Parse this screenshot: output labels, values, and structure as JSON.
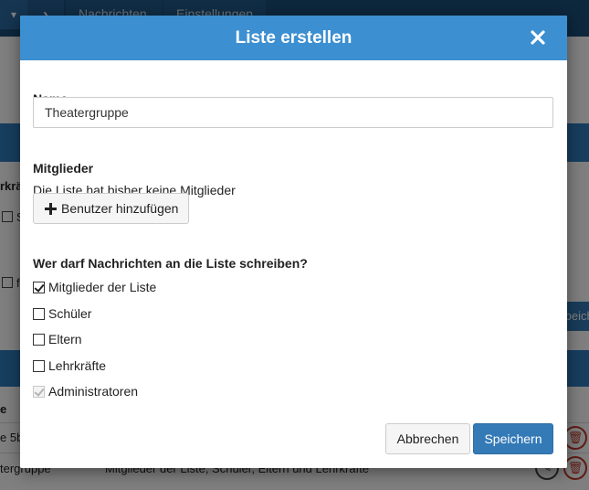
{
  "background": {
    "tabs": [
      "Nachrichten",
      "Einstellungen"
    ],
    "left_labels": [
      "rkrä",
      "S",
      "f"
    ],
    "save_label": "Speich",
    "table_header": "e",
    "rows": [
      {
        "name": "e 5b",
        "members": ""
      },
      {
        "name": "tergruppe",
        "members": "Mitglieder der Liste, Schüler, Eltern und Lehrkräfte"
      }
    ]
  },
  "modal": {
    "title": "Liste erstellen",
    "close_icon": "close-icon",
    "name_label": "Name",
    "name_value": "Theatergruppe",
    "members_label": "Mitglieder",
    "members_empty_text": "Die Liste hat bisher keine Mitglieder",
    "add_user_label": "Benutzer hinzufügen",
    "add_user_icon": "plus-icon",
    "permissions_label": "Wer darf Nachrichten an die Liste schreiben?",
    "permissions": [
      {
        "label": "Mitglieder der Liste",
        "checked": true,
        "disabled": false
      },
      {
        "label": "Schüler",
        "checked": false,
        "disabled": false
      },
      {
        "label": "Eltern",
        "checked": false,
        "disabled": false
      },
      {
        "label": "Lehrkräfte",
        "checked": false,
        "disabled": false
      },
      {
        "label": "Administratoren",
        "checked": true,
        "disabled": true
      }
    ],
    "cancel_label": "Abbrechen",
    "save_label": "Speichern"
  },
  "colors": {
    "header_blue": "#3c8fd1",
    "primary_button": "#337ab7"
  }
}
